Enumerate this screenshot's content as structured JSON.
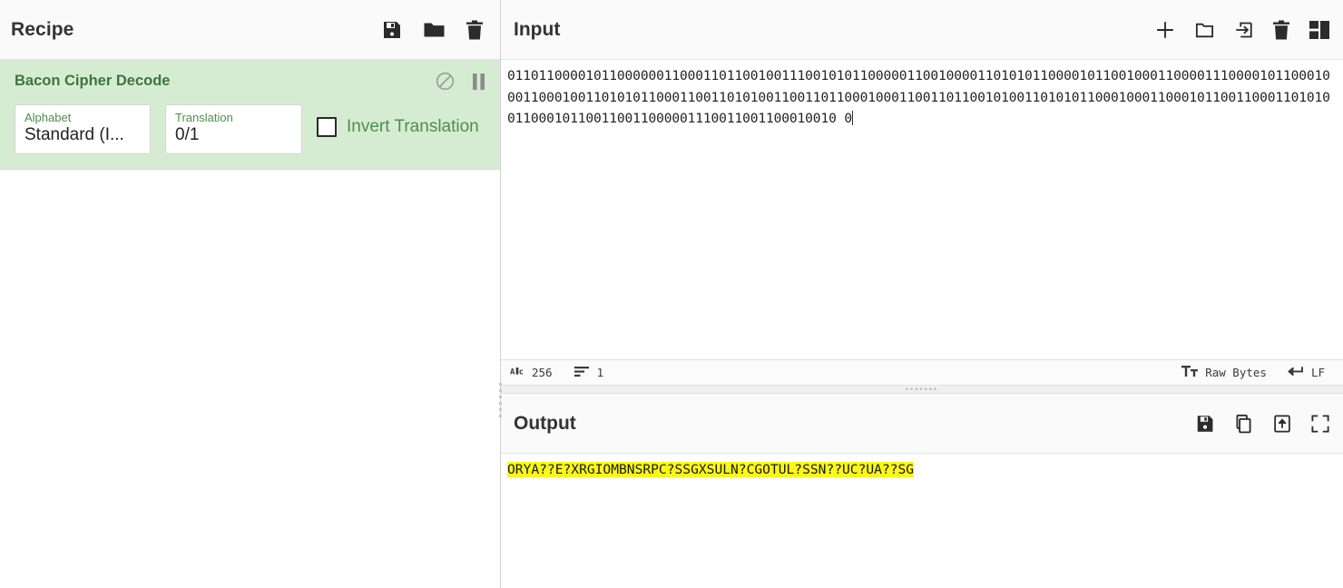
{
  "recipe": {
    "title": "Recipe",
    "icons": [
      {
        "name": "save-recipe-icon",
        "glyph": "floppy"
      },
      {
        "name": "load-recipe-icon",
        "glyph": "folder"
      },
      {
        "name": "clear-recipe-icon",
        "glyph": "trash"
      }
    ],
    "operation": {
      "name": "Bacon Cipher Decode",
      "disable_icon": "disable-operation-icon",
      "pause_icon": "pause-breakpoint-icon",
      "args": {
        "alphabet": {
          "label": "Alphabet",
          "value": "Standard (I..."
        },
        "translation": {
          "label": "Translation",
          "value": "0/1"
        },
        "invert": {
          "label": "Invert Translation",
          "checked": false
        }
      }
    }
  },
  "input": {
    "title": "Input",
    "icons": [
      {
        "name": "add-input-tab-icon",
        "glyph": "plus"
      },
      {
        "name": "open-folder-as-input-icon",
        "glyph": "folder-open"
      },
      {
        "name": "open-file-as-input-icon",
        "glyph": "file-in"
      },
      {
        "name": "clear-input-icon",
        "glyph": "trash"
      },
      {
        "name": "reset-pane-layout-icon",
        "glyph": "layout"
      }
    ],
    "text": "011011000010110000001100011011001001110010101100000110010000110101011000010110010001100001110000101100010001100010011010101100011001101010011001101100010001100110110010100110101011000100011000101100110001101010011000101100110011000001110011001100010010 0",
    "status": {
      "length_icon": "character-count-icon",
      "length": "256",
      "lines_icon": "line-count-icon",
      "lines": "1",
      "encoding_icon": "text-encoding-icon",
      "encoding": "Raw Bytes",
      "eol_icon": "line-ending-icon",
      "eol": "LF"
    }
  },
  "output": {
    "title": "Output",
    "icons": [
      {
        "name": "save-output-icon",
        "glyph": "floppy"
      },
      {
        "name": "copy-output-icon",
        "glyph": "copy"
      },
      {
        "name": "replace-input-with-output-icon",
        "glyph": "file-up"
      },
      {
        "name": "maximise-output-icon",
        "glyph": "expand"
      }
    ],
    "text": "ORYA??E?XRGIOMBNSRPC?SSGXSULN?CGOTUL?SSN??UC?UA??SG"
  },
  "colors": {
    "operation_bg": "#d6ecd2",
    "operation_text": "#3c763d",
    "highlight": "#fbf719",
    "pane_header_bg": "#fafafa"
  }
}
